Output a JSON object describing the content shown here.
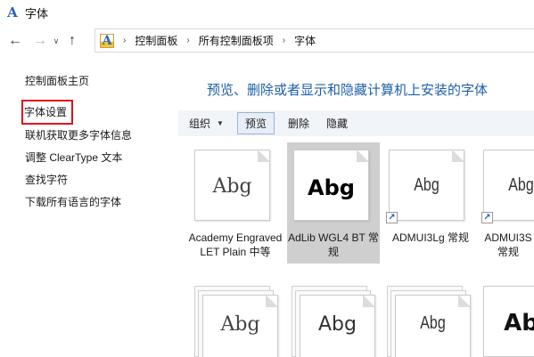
{
  "window": {
    "title": "字体",
    "app_icon_glyph": "A"
  },
  "nav": {
    "back_glyph": "←",
    "forward_glyph": "→",
    "dropdown_glyph": "∨",
    "up_glyph": "↑",
    "breadcrumb": [
      "控制面板",
      "所有控制面板项",
      "字体"
    ],
    "separator": "›"
  },
  "sidebar": {
    "home": "控制面板主页",
    "links": [
      "字体设置",
      "联机获取更多字体信息",
      "调整 ClearType 文本",
      "查找字符",
      "下载所有语言的字体"
    ],
    "highlighted_index": 0,
    "highlight_color": "#e0101c"
  },
  "main": {
    "heading": "预览、删除或者显示和隐藏计算机上安装的字体",
    "heading_color": "#1e5fa8"
  },
  "toolbar": {
    "organize": "组织",
    "organize_arrow": "▼",
    "preview": "预览",
    "delete": "删除",
    "hide": "隐藏"
  },
  "fonts": [
    {
      "sample": "Abg",
      "label": "Academy Engraved LET Plain 中等",
      "shortcut": false,
      "stacked": false,
      "selected": false
    },
    {
      "sample": "Abg",
      "label": "AdLib WGL4 BT 常规",
      "shortcut": false,
      "stacked": false,
      "selected": true
    },
    {
      "sample": "Abg",
      "label": "ADMUI3Lg 常规",
      "shortcut": true,
      "stacked": false,
      "selected": false
    },
    {
      "sample": "Abg",
      "label": "ADMUI3S 常规",
      "shortcut": true,
      "stacked": false,
      "selected": false
    },
    {
      "sample": "Abg",
      "label": "",
      "shortcut": false,
      "stacked": true,
      "selected": false
    },
    {
      "sample": "Abg",
      "label": "",
      "shortcut": false,
      "stacked": true,
      "selected": false
    },
    {
      "sample": "Abg",
      "label": "",
      "shortcut": false,
      "stacked": true,
      "selected": false
    },
    {
      "sample": "Ab",
      "label": "",
      "shortcut": false,
      "stacked": true,
      "selected": false
    }
  ],
  "shortcut_glyph": "↗"
}
